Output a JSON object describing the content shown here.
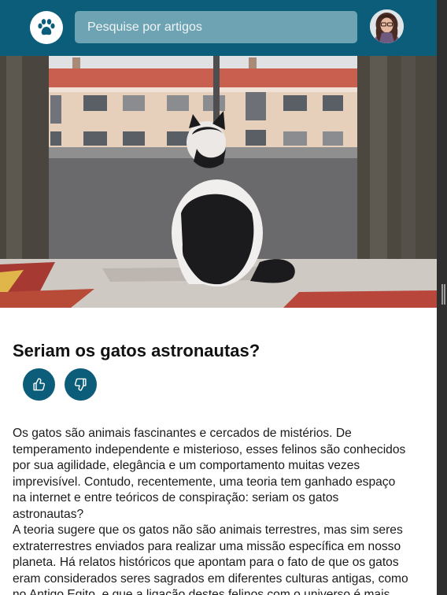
{
  "header": {
    "logo_icon": "paw-icon",
    "search": {
      "placeholder": "Pesquise por artigos",
      "value": ""
    },
    "avatar_icon": "user-avatar"
  },
  "article": {
    "title": "Seriam os gatos astronautas?",
    "like_icon": "thumbs-up-icon",
    "dislike_icon": "thumbs-down-icon",
    "paragraphs": [
      "Os gatos são animais fascinantes e cercados de mistérios. De temperamento independente e misterioso, esses felinos são conhecidos por sua agilidade, elegância e um comportamento muitas vezes imprevisível. Contudo, recentemente, uma teoria tem ganhado espaço na internet e entre teóricos de conspiração: seriam os gatos astronautas?",
      "A teoria sugere que os gatos não são animais terrestres, mas sim seres extraterrestres enviados para realizar uma missão específica em nosso planeta. Há relatos históricos que apontam para o fato de que os gatos eram considerados seres sagrados em diferentes culturas antigas, como no Antigo Egito, e que a ligação destes felinos com o universo é mais antiga do que imaginamos."
    ]
  },
  "colors": {
    "brand": "#0c5d7a",
    "search_bg": "#6ea3b3",
    "text": "#1a1a1a"
  }
}
